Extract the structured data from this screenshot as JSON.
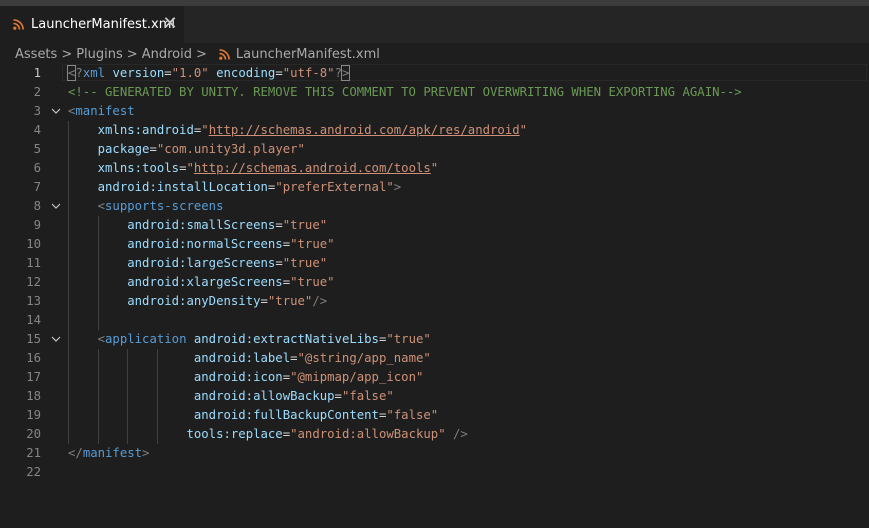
{
  "tab": {
    "filename": "LauncherManifest.xml",
    "close_glyph": "✕",
    "icon": "rss-icon"
  },
  "breadcrumb": {
    "items": [
      "Assets",
      "Plugins",
      "Android"
    ],
    "file": "LauncherManifest.xml",
    "separator": ">"
  },
  "colors": {
    "tag": "#569cd6",
    "attribute": "#9cdcfe",
    "string": "#ce9178",
    "comment": "#6a9955",
    "bracket": "#808080",
    "file_icon": "#e37933"
  },
  "editor": {
    "active_line": 1,
    "lines": [
      {
        "n": "1",
        "fold": false,
        "tokens": [
          [
            "br",
            "<"
          ],
          [
            "br",
            "?"
          ],
          [
            "tag",
            "xml"
          ],
          [
            "pl",
            " "
          ],
          [
            "attr",
            "version"
          ],
          [
            "eq",
            "="
          ],
          [
            "str",
            "\"1.0\""
          ],
          [
            "pl",
            " "
          ],
          [
            "attr",
            "encoding"
          ],
          [
            "eq",
            "="
          ],
          [
            "str",
            "\"utf-8\""
          ],
          [
            "br",
            "?"
          ],
          [
            "br",
            ">"
          ]
        ]
      },
      {
        "n": "2",
        "fold": false,
        "tokens": [
          [
            "cm",
            "<!-- GENERATED BY UNITY. REMOVE THIS COMMENT TO PREVENT OVERWRITING WHEN EXPORTING AGAIN-->"
          ]
        ]
      },
      {
        "n": "3",
        "fold": true,
        "tokens": [
          [
            "br",
            "<"
          ],
          [
            "tag",
            "manifest"
          ]
        ]
      },
      {
        "n": "4",
        "fold": false,
        "tokens": [
          [
            "pl",
            "    "
          ],
          [
            "attr",
            "xmlns:android"
          ],
          [
            "eq",
            "="
          ],
          [
            "str",
            "\""
          ],
          [
            "url",
            "http://schemas.android.com/apk/res/android"
          ],
          [
            "str",
            "\""
          ]
        ]
      },
      {
        "n": "5",
        "fold": false,
        "tokens": [
          [
            "pl",
            "    "
          ],
          [
            "attr",
            "package"
          ],
          [
            "eq",
            "="
          ],
          [
            "str",
            "\"com.unity3d.player\""
          ]
        ]
      },
      {
        "n": "6",
        "fold": false,
        "tokens": [
          [
            "pl",
            "    "
          ],
          [
            "attr",
            "xmlns:tools"
          ],
          [
            "eq",
            "="
          ],
          [
            "str",
            "\""
          ],
          [
            "url",
            "http://schemas.android.com/tools"
          ],
          [
            "str",
            "\""
          ]
        ]
      },
      {
        "n": "7",
        "fold": false,
        "tokens": [
          [
            "pl",
            "    "
          ],
          [
            "attr",
            "android:installLocation"
          ],
          [
            "eq",
            "="
          ],
          [
            "str",
            "\"preferExternal\""
          ],
          [
            "br",
            ">"
          ]
        ]
      },
      {
        "n": "8",
        "fold": true,
        "tokens": [
          [
            "pl",
            "    "
          ],
          [
            "br",
            "<"
          ],
          [
            "tag",
            "supports-screens"
          ]
        ]
      },
      {
        "n": "9",
        "fold": false,
        "tokens": [
          [
            "pl",
            "        "
          ],
          [
            "attr",
            "android:smallScreens"
          ],
          [
            "eq",
            "="
          ],
          [
            "str",
            "\"true\""
          ]
        ]
      },
      {
        "n": "10",
        "fold": false,
        "tokens": [
          [
            "pl",
            "        "
          ],
          [
            "attr",
            "android:normalScreens"
          ],
          [
            "eq",
            "="
          ],
          [
            "str",
            "\"true\""
          ]
        ]
      },
      {
        "n": "11",
        "fold": false,
        "tokens": [
          [
            "pl",
            "        "
          ],
          [
            "attr",
            "android:largeScreens"
          ],
          [
            "eq",
            "="
          ],
          [
            "str",
            "\"true\""
          ]
        ]
      },
      {
        "n": "12",
        "fold": false,
        "tokens": [
          [
            "pl",
            "        "
          ],
          [
            "attr",
            "android:xlargeScreens"
          ],
          [
            "eq",
            "="
          ],
          [
            "str",
            "\"true\""
          ]
        ]
      },
      {
        "n": "13",
        "fold": false,
        "tokens": [
          [
            "pl",
            "        "
          ],
          [
            "attr",
            "android:anyDensity"
          ],
          [
            "eq",
            "="
          ],
          [
            "str",
            "\"true\""
          ],
          [
            "br",
            "/>"
          ]
        ]
      },
      {
        "n": "14",
        "fold": false,
        "tokens": []
      },
      {
        "n": "15",
        "fold": true,
        "tokens": [
          [
            "pl",
            "    "
          ],
          [
            "br",
            "<"
          ],
          [
            "tag",
            "application"
          ],
          [
            "pl",
            " "
          ],
          [
            "attr",
            "android:extractNativeLibs"
          ],
          [
            "eq",
            "="
          ],
          [
            "str",
            "\"true\""
          ]
        ]
      },
      {
        "n": "16",
        "fold": false,
        "tokens": [
          [
            "pl",
            "                 "
          ],
          [
            "attr",
            "android:label"
          ],
          [
            "eq",
            "="
          ],
          [
            "str",
            "\"@string/app_name\""
          ]
        ]
      },
      {
        "n": "17",
        "fold": false,
        "tokens": [
          [
            "pl",
            "                 "
          ],
          [
            "attr",
            "android:icon"
          ],
          [
            "eq",
            "="
          ],
          [
            "str",
            "\"@mipmap/app_icon\""
          ]
        ]
      },
      {
        "n": "18",
        "fold": false,
        "tokens": [
          [
            "pl",
            "                 "
          ],
          [
            "attr",
            "android:allowBackup"
          ],
          [
            "eq",
            "="
          ],
          [
            "str",
            "\"false\""
          ]
        ]
      },
      {
        "n": "19",
        "fold": false,
        "tokens": [
          [
            "pl",
            "                 "
          ],
          [
            "attr",
            "android:fullBackupContent"
          ],
          [
            "eq",
            "="
          ],
          [
            "str",
            "\"false\""
          ]
        ]
      },
      {
        "n": "20",
        "fold": false,
        "tokens": [
          [
            "pl",
            "                "
          ],
          [
            "attr",
            "tools:replace"
          ],
          [
            "eq",
            "="
          ],
          [
            "str",
            "\"android:allowBackup\""
          ],
          [
            "pl",
            " "
          ],
          [
            "br",
            "/>"
          ]
        ]
      },
      {
        "n": "21",
        "fold": false,
        "tokens": [
          [
            "br",
            "</"
          ],
          [
            "tag",
            "manifest"
          ],
          [
            "br",
            ">"
          ]
        ]
      },
      {
        "n": "22",
        "fold": false,
        "tokens": []
      }
    ]
  }
}
